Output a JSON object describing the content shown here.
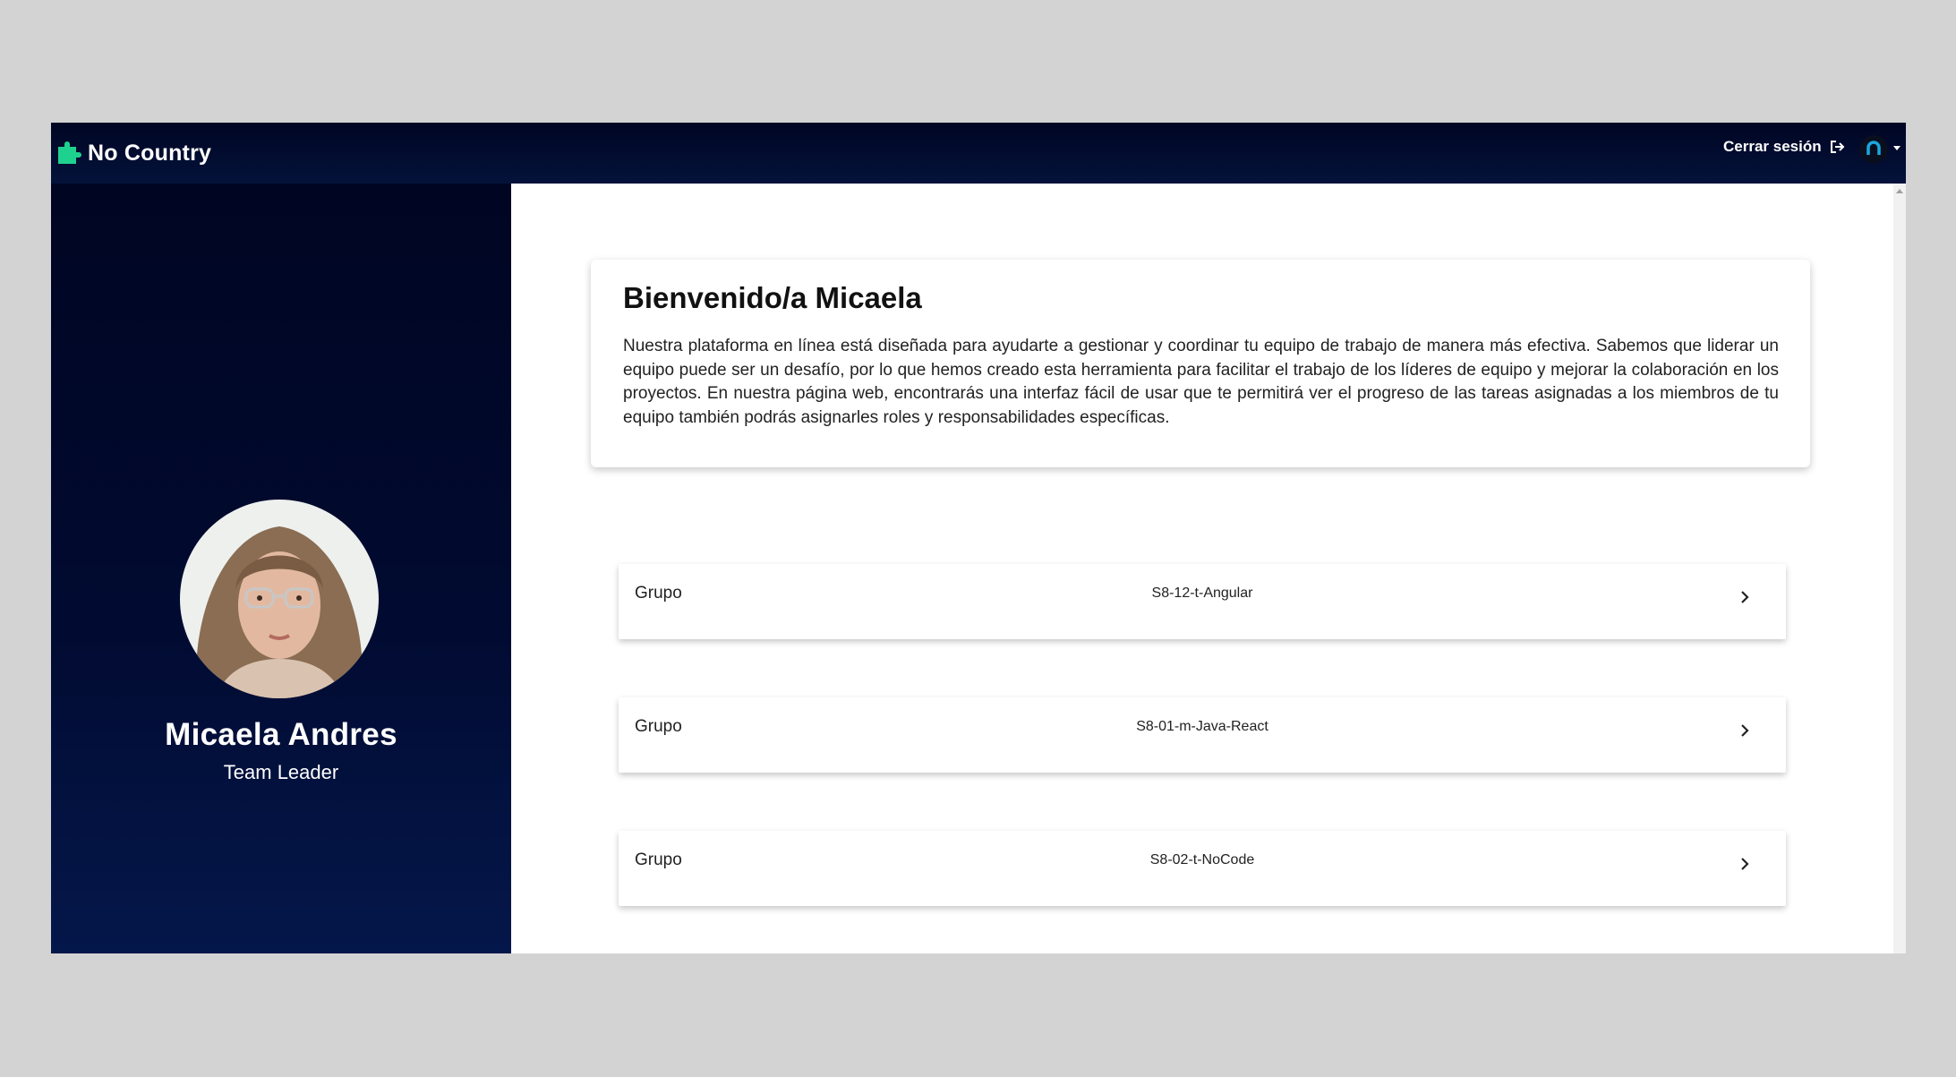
{
  "header": {
    "brand": "No Country",
    "logout_label": "Cerrar sesión",
    "colors": {
      "background": "#000624",
      "brand_accent": "#1fd18f"
    }
  },
  "profile": {
    "name": "Micaela Andres",
    "role": "Team Leader"
  },
  "welcome": {
    "title": "Bienvenido/a Micaela",
    "text": "Nuestra plataforma en línea está diseñada para ayudarte a gestionar y coordinar tu equipo de trabajo de manera más efectiva. Sabemos que liderar un equipo puede ser un desafío, por lo que hemos creado esta herramienta para facilitar el trabajo de los líderes de equipo y mejorar la colaboración en los proyectos. En nuestra página web, encontrarás una interfaz fácil de usar que te permitirá ver el progreso de las tareas asignadas a los miembros de tu equipo también podrás asignarles roles y responsabilidades específicas."
  },
  "groups": [
    {
      "label": "Grupo",
      "name": "S8-12-t-Angular"
    },
    {
      "label": "Grupo",
      "name": "S8-01-m-Java-React"
    },
    {
      "label": "Grupo",
      "name": "S8-02-t-NoCode"
    }
  ],
  "icons": {
    "brand": "puzzle-piece-icon",
    "logout": "logout-icon",
    "user": "user-avatar-icon",
    "group_open": "chevron-right-icon"
  }
}
